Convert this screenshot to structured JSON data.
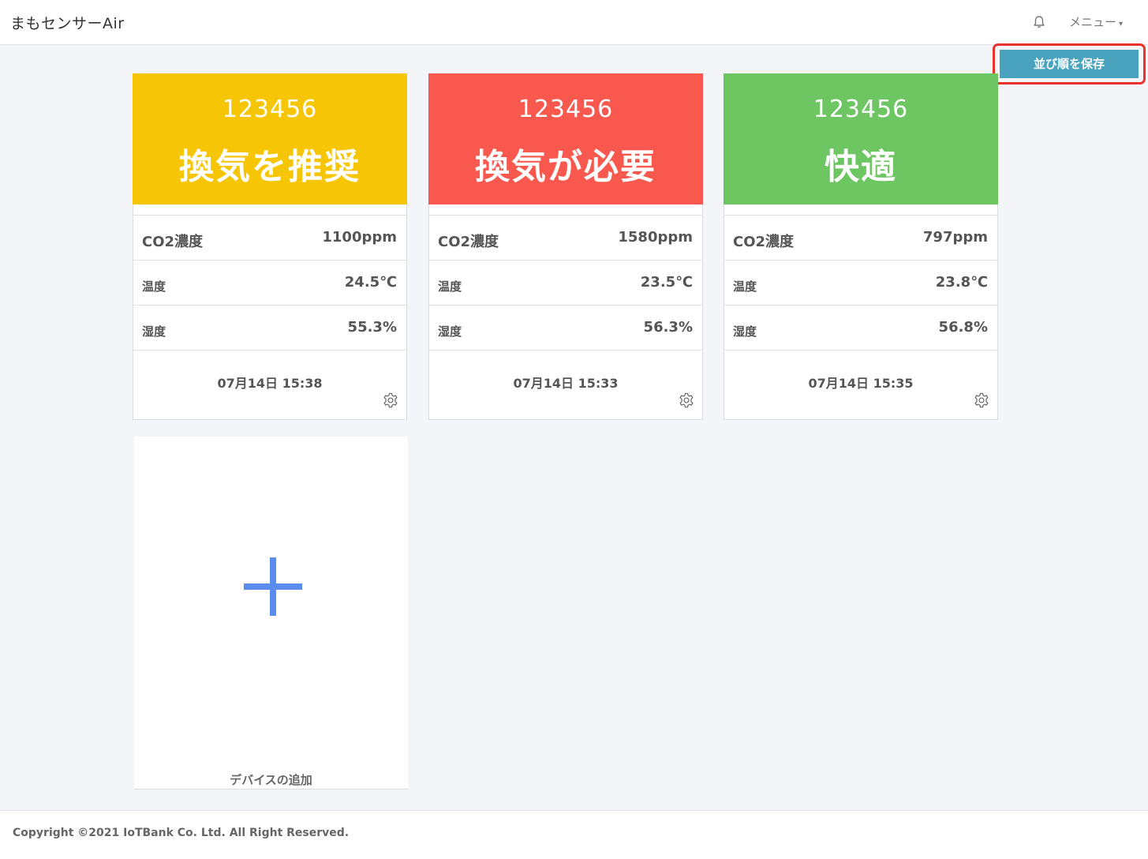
{
  "app": {
    "brand": "まもセンサーAir",
    "menu_label": "メニュー",
    "menu_caret": "▾",
    "bell_icon": "bell-icon"
  },
  "toolbar": {
    "save_order_label": "並び順を保存",
    "save_order_color": "#4aa3be",
    "highlight_color": "#e8322c"
  },
  "devices": [
    {
      "id": "123456",
      "status": "換気を推奨",
      "status_color": "#f5c506",
      "co2_label": "CO2濃度",
      "co2_value": "1100ppm",
      "temp_label": "温度",
      "temp_value": "24.5℃",
      "humidity_label": "湿度",
      "humidity_value": "55.3%",
      "timestamp": "07月14日 15:38",
      "settings_icon": "gear-icon"
    },
    {
      "id": "123456",
      "status": "換気が必要",
      "status_color": "#f8584d",
      "co2_label": "CO2濃度",
      "co2_value": "1580ppm",
      "temp_label": "温度",
      "temp_value": "23.5℃",
      "humidity_label": "湿度",
      "humidity_value": "56.3%",
      "timestamp": "07月14日 15:33",
      "settings_icon": "gear-icon"
    },
    {
      "id": "123456",
      "status": "快適",
      "status_color": "#6ec662",
      "co2_label": "CO2濃度",
      "co2_value": "797ppm",
      "temp_label": "温度",
      "temp_value": "23.8℃",
      "humidity_label": "湿度",
      "humidity_value": "56.8%",
      "timestamp": "07月14日 15:35",
      "settings_icon": "gear-icon"
    }
  ],
  "add_device": {
    "label": "デバイスの追加",
    "icon": "plus-icon",
    "icon_color": "#5b8def"
  },
  "footer": {
    "copyright": "Copyright ©2021 IoTBank Co. Ltd. All Right Reserved."
  }
}
